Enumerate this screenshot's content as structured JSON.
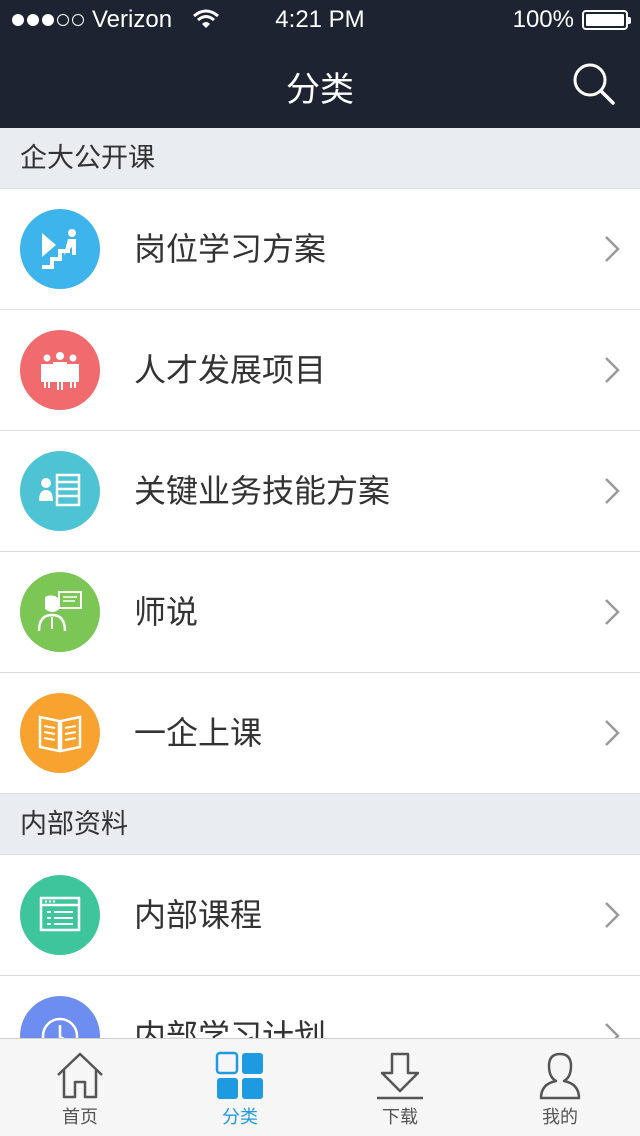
{
  "status": {
    "carrier": "Verizon",
    "time": "4:21 PM",
    "battery": "100%"
  },
  "header": {
    "title": "分类"
  },
  "sections": [
    {
      "title": "企大公开课",
      "items": [
        {
          "label": "岗位学习方案",
          "color": "#3db4ec",
          "icon": "stairs-climb-icon"
        },
        {
          "label": "人才发展项目",
          "color": "#f06a6e",
          "icon": "team-icon"
        },
        {
          "label": "关键业务技能方案",
          "color": "#4ec3d4",
          "icon": "person-list-icon"
        },
        {
          "label": "师说",
          "color": "#7cc656",
          "icon": "teacher-icon"
        },
        {
          "label": "一企上课",
          "color": "#f8a22f",
          "icon": "book-icon"
        }
      ]
    },
    {
      "title": "内部资料",
      "items": [
        {
          "label": "内部课程",
          "color": "#3fc59b",
          "icon": "browser-list-icon"
        },
        {
          "label": "内部学习计划",
          "color": "#6d8ef0",
          "icon": "clock-icon"
        }
      ]
    }
  ],
  "tabs": [
    {
      "label": "首页",
      "icon": "home-icon"
    },
    {
      "label": "分类",
      "icon": "grid-icon",
      "active": true
    },
    {
      "label": "下载",
      "icon": "download-icon"
    },
    {
      "label": "我的",
      "icon": "person-icon"
    }
  ],
  "colors": {
    "header_bg": "#1d2330",
    "accent": "#1e9be0",
    "section_bg": "#e9ecf0"
  }
}
